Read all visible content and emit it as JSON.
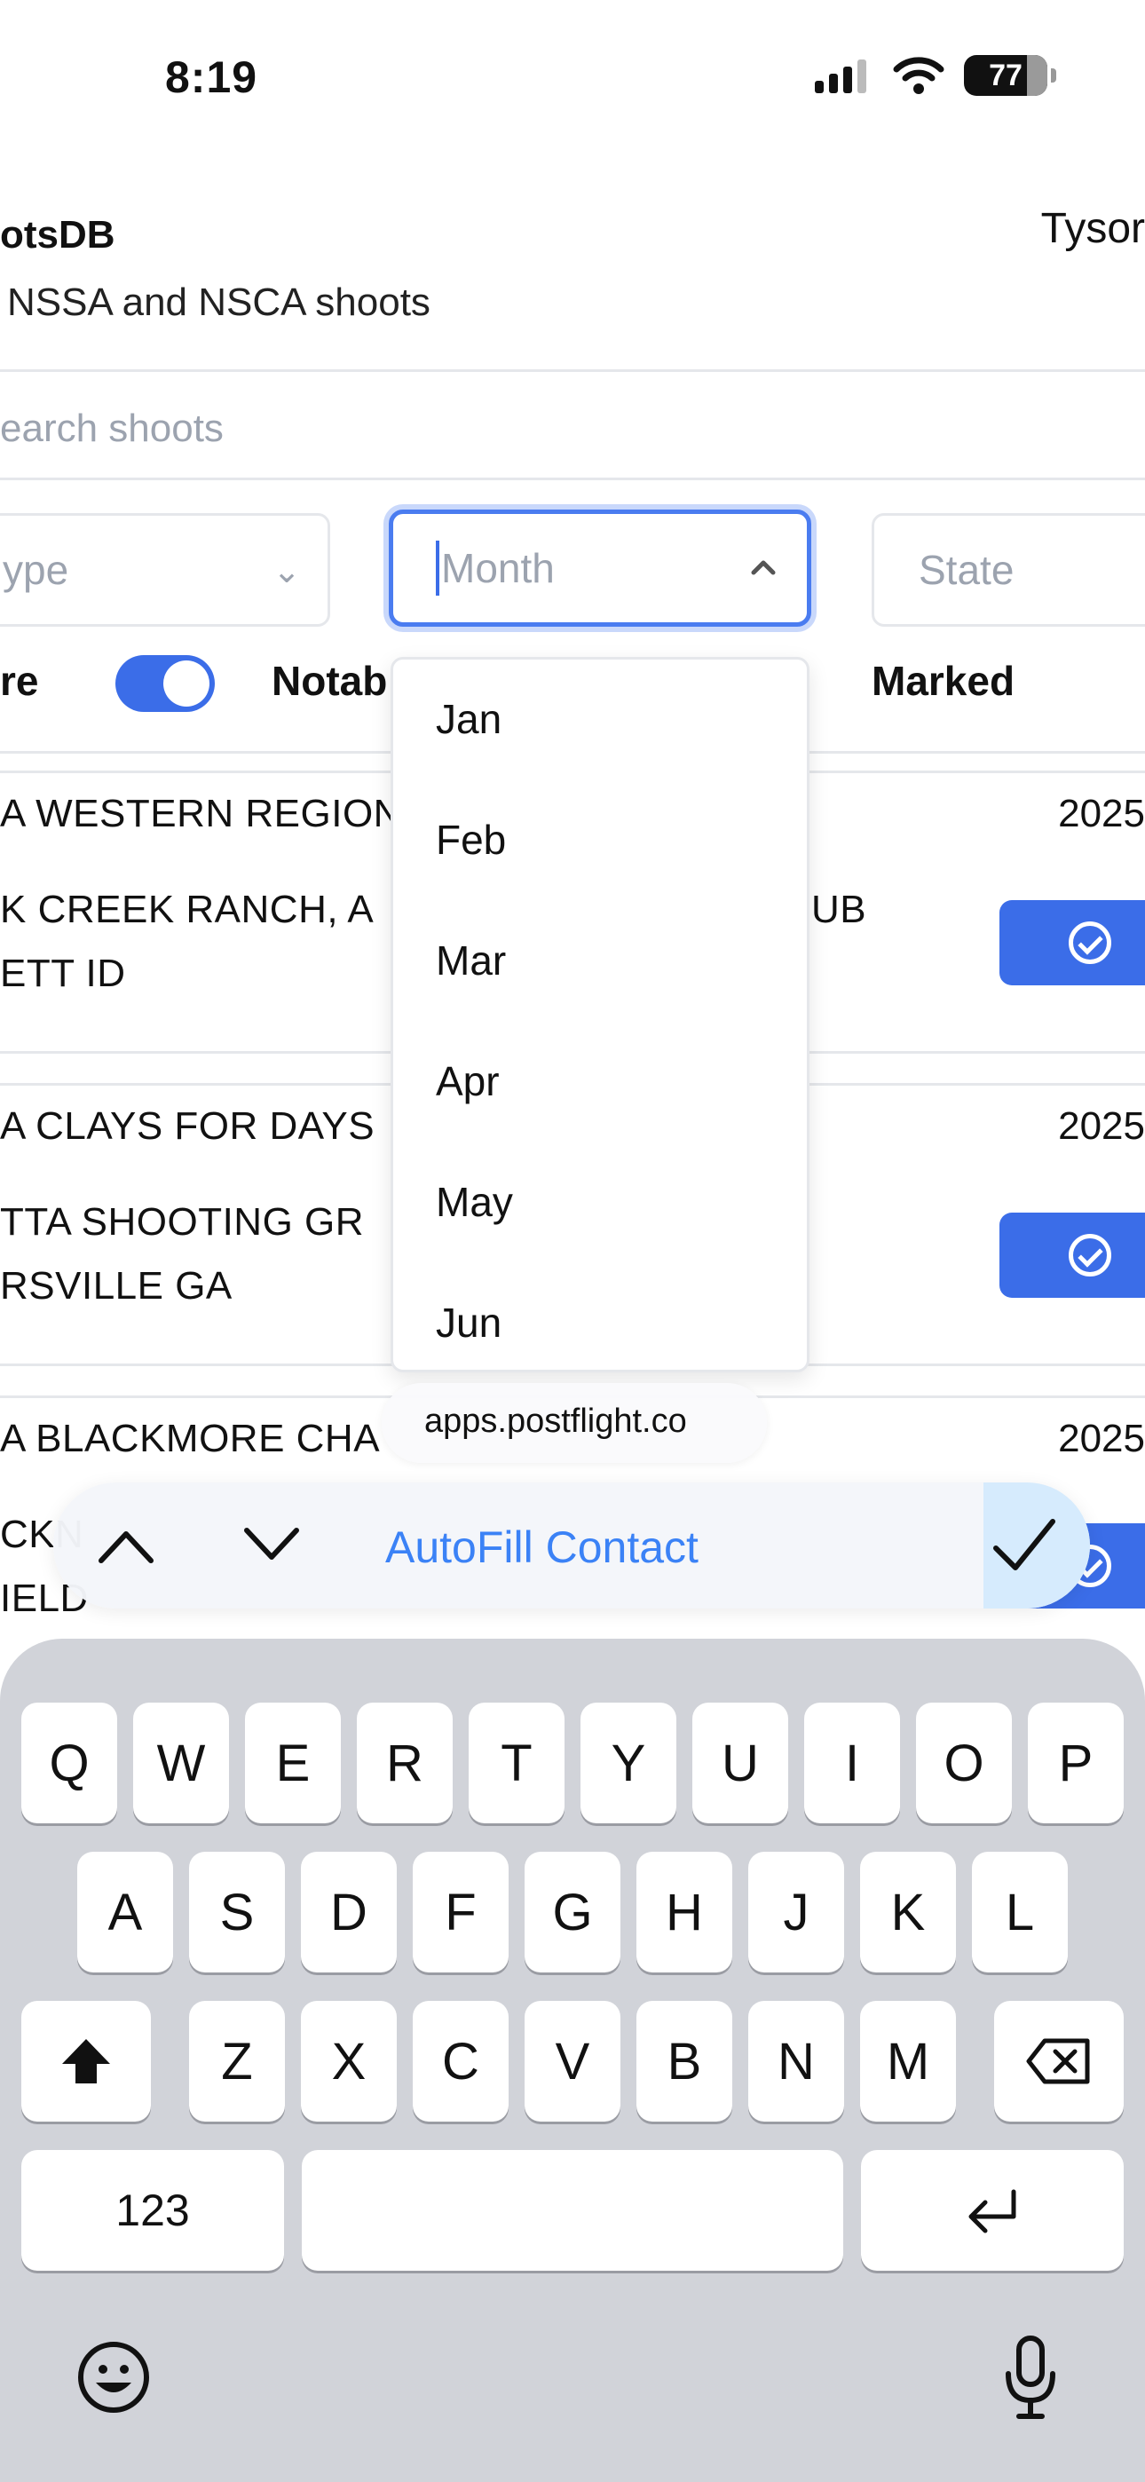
{
  "status_bar": {
    "time": "8:19",
    "battery": "77",
    "battery_level": 0.77
  },
  "header": {
    "app_title": "otsDB",
    "subtitle": "NSSA and NSCA shoots",
    "user_name": "Tysor"
  },
  "search": {
    "placeholder": "earch shoots"
  },
  "filters": {
    "type_placeholder": "ype",
    "month_placeholder": "Month",
    "state_placeholder": "State",
    "toggle_label_left": "re",
    "toggle_on": true,
    "notable_label": "Notab",
    "marked_label": "Marked"
  },
  "shoots": [
    {
      "title": "A WESTERN REGION",
      "year": "2025",
      "location_line1": "K CREEK RANCH, A",
      "location_line1_tail": "UB",
      "location_line2": "ETT ID"
    },
    {
      "title": "A CLAYS FOR DAYS",
      "year": "2025",
      "location_line1": "TTA SHOOTING GR",
      "location_line2": "RSVILLE GA"
    },
    {
      "title": "A BLACKMORE CHA",
      "year": "2025",
      "location_line1": "CKN",
      "location_line2": "IELD"
    }
  ],
  "month_dropdown": {
    "options": [
      "Jan",
      "Feb",
      "Mar",
      "Apr",
      "May",
      "Jun"
    ]
  },
  "autofill": {
    "url": "apps.postflight.co",
    "label": "AutoFill Contact"
  },
  "keyboard": {
    "row1": [
      "Q",
      "W",
      "E",
      "R",
      "T",
      "Y",
      "U",
      "I",
      "O",
      "P"
    ],
    "row2": [
      "A",
      "S",
      "D",
      "F",
      "G",
      "H",
      "J",
      "K",
      "L"
    ],
    "row3": [
      "Z",
      "X",
      "C",
      "V",
      "B",
      "N",
      "M"
    ],
    "numbers_label": "123"
  },
  "colors": {
    "accent": "#3b6de8",
    "autofill_text": "#3b82f6",
    "keyboard_bg": "#d1d3d9"
  }
}
